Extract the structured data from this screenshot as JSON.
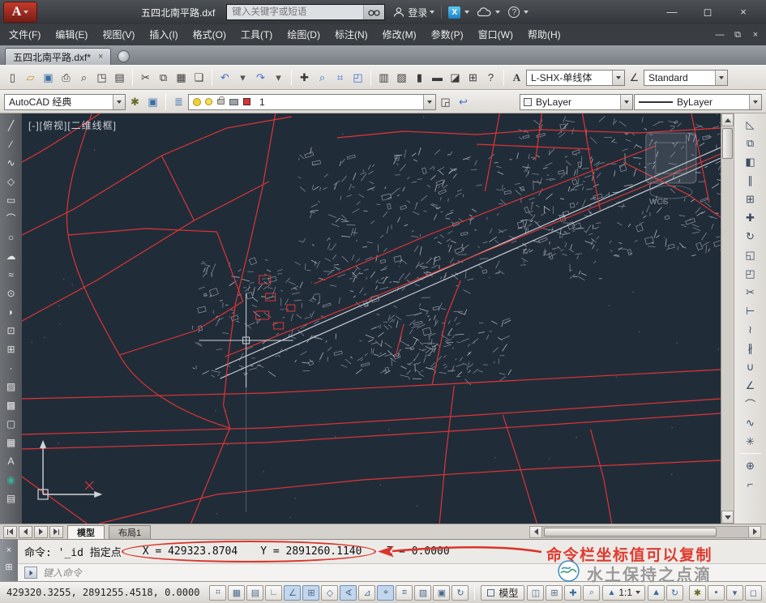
{
  "colors": {
    "accent_red": "#d9352a",
    "canvas_bg": "#212c39",
    "cad_red": "#e23535",
    "map_gray": "#97a0ac"
  },
  "title_bar": {
    "app_label": "A",
    "document_title": "五四北南平路.dxf",
    "search_placeholder": "键入关键字或短语",
    "login_label": "登录",
    "exchange_glyph": "X",
    "help_glyph": "?",
    "window_controls": {
      "minimize": "—",
      "maximize": "◻",
      "close": "×"
    }
  },
  "menu_bar": {
    "items": [
      "文件(F)",
      "编辑(E)",
      "视图(V)",
      "插入(I)",
      "格式(O)",
      "工具(T)",
      "绘图(D)",
      "标注(N)",
      "修改(M)",
      "参数(P)",
      "窗口(W)",
      "帮助(H)"
    ],
    "doc_window_controls": {
      "minimize": "—",
      "restore": "⧉",
      "close": "×"
    }
  },
  "tab_bar": {
    "tab_label": "五四北南平路.dxf*",
    "tab_close_glyph": "×"
  },
  "toolbar_standard": {
    "icons": [
      {
        "name": "new-file-icon",
        "glyph": "▯"
      },
      {
        "name": "open-file-icon",
        "glyph": "▱",
        "color": "#c89530"
      },
      {
        "name": "save-icon",
        "glyph": "▣",
        "color": "#3a6ea5"
      },
      {
        "name": "print-icon",
        "glyph": "⎙"
      },
      {
        "name": "plot-preview-icon",
        "glyph": "⌕"
      },
      {
        "name": "publish-icon",
        "glyph": "◳"
      },
      {
        "name": "export-dwf-icon",
        "glyph": "▤"
      },
      {
        "sep": true
      },
      {
        "name": "cut-icon",
        "glyph": "✂"
      },
      {
        "name": "copy-clip-icon",
        "glyph": "⧉"
      },
      {
        "name": "paste-icon",
        "glyph": "▦"
      },
      {
        "name": "match-properties-icon",
        "glyph": "❏"
      },
      {
        "sep": true
      },
      {
        "name": "undo-icon",
        "glyph": "↶",
        "color": "#3f6fd0"
      },
      {
        "name": "undo-caret-icon",
        "glyph": "▾",
        "color": "#555"
      },
      {
        "name": "redo-icon",
        "glyph": "↷",
        "color": "#3f6fd0"
      },
      {
        "name": "redo-caret-icon",
        "glyph": "▾",
        "color": "#555"
      },
      {
        "sep": true
      },
      {
        "name": "pan-icon",
        "glyph": "✚"
      },
      {
        "name": "zoom-realtime-icon",
        "glyph": "⌕",
        "color": "#3f6fd0"
      },
      {
        "name": "zoom-window-icon",
        "glyph": "⌗",
        "color": "#3f6fd0"
      },
      {
        "name": "zoom-previous-icon",
        "glyph": "◰",
        "color": "#3f6fd0"
      },
      {
        "sep": true
      },
      {
        "name": "properties-palette-icon",
        "glyph": "▥"
      },
      {
        "name": "designcenter-icon",
        "glyph": "▨"
      },
      {
        "name": "tool-palettes-icon",
        "glyph": "▮"
      },
      {
        "name": "sheet-set-manager-icon",
        "glyph": "▬"
      },
      {
        "name": "markup-set-manager-icon",
        "glyph": "◪"
      },
      {
        "name": "quickcalc-icon",
        "glyph": "⊞"
      },
      {
        "name": "help-icon",
        "glyph": "?"
      }
    ],
    "text_style_icon": "A",
    "text_style_value": "L-SHX-单线体",
    "dim_style_icon": "∠",
    "dim_style_value": "Standard"
  },
  "toolbar_properties": {
    "workspace_value": "AutoCAD 经典",
    "workspace_icons": [
      {
        "name": "workspace-settings-icon",
        "glyph": "✱",
        "color": "#6a6a28"
      },
      {
        "name": "workspace-save-icon",
        "glyph": "▣",
        "color": "#3a6ea5"
      }
    ],
    "layer_panel_icons": [
      {
        "name": "layer-properties-manager-icon",
        "glyph": "≣",
        "color": "#3a6ea5"
      }
    ],
    "layer_name": "1",
    "layer_tool_icons": [
      {
        "name": "make-layer-current-icon",
        "glyph": "◲"
      },
      {
        "name": "layer-previous-icon",
        "glyph": "↩",
        "color": "#3f6fd0"
      }
    ],
    "color_value": "ByLayer",
    "linetype_value": "ByLayer"
  },
  "canvas": {
    "viewport_label": "[-][俯视][二维线框]",
    "wcs_label": "WCS"
  },
  "left_toolbar": {
    "icons": [
      {
        "name": "line-icon",
        "glyph": "╱"
      },
      {
        "name": "construction-line-icon",
        "glyph": "∕"
      },
      {
        "name": "polyline-icon",
        "glyph": "∿"
      },
      {
        "name": "polygon-icon",
        "glyph": "◇"
      },
      {
        "name": "rectangle-icon",
        "glyph": "▭"
      },
      {
        "name": "arc-icon",
        "glyph": "⌒"
      },
      {
        "name": "circle-icon",
        "glyph": "○"
      },
      {
        "name": "revision-cloud-icon",
        "glyph": "☁"
      },
      {
        "name": "spline-icon",
        "glyph": "≈"
      },
      {
        "name": "ellipse-icon",
        "glyph": "⊙"
      },
      {
        "name": "ellipse-arc-icon",
        "glyph": "◗"
      },
      {
        "name": "insert-block-icon",
        "glyph": "⊡"
      },
      {
        "name": "create-block-icon",
        "glyph": "⊞"
      },
      {
        "name": "point-icon",
        "glyph": "∙"
      },
      {
        "name": "hatch-icon",
        "glyph": "▨"
      },
      {
        "name": "gradient-icon",
        "glyph": "▩"
      },
      {
        "name": "region-icon",
        "glyph": "▢"
      },
      {
        "name": "table-icon",
        "glyph": "▦"
      },
      {
        "name": "multiline-text-icon",
        "glyph": "A"
      },
      {
        "name": "point-style-icon",
        "glyph": "◉",
        "color": "#35b09a"
      },
      {
        "name": "named-views-icon",
        "glyph": "▤"
      }
    ]
  },
  "right_toolbar": {
    "icons": [
      {
        "name": "erase-icon",
        "glyph": "◺"
      },
      {
        "name": "copy-icon",
        "glyph": "⧉"
      },
      {
        "name": "mirror-icon",
        "glyph": "◧"
      },
      {
        "name": "offset-icon",
        "glyph": "∥"
      },
      {
        "name": "array-icon",
        "glyph": "⊞"
      },
      {
        "name": "move-icon",
        "glyph": "✚"
      },
      {
        "name": "rotate-icon",
        "glyph": "↻"
      },
      {
        "name": "scale-icon",
        "glyph": "◱"
      },
      {
        "name": "stretch-icon",
        "glyph": "◰"
      },
      {
        "name": "trim-icon",
        "glyph": "✂"
      },
      {
        "name": "extend-icon",
        "glyph": "⊢"
      },
      {
        "name": "break-at-point-icon",
        "glyph": "≀"
      },
      {
        "name": "break-icon",
        "glyph": "∦"
      },
      {
        "name": "join-icon",
        "glyph": "∪"
      },
      {
        "name": "chamfer-icon",
        "glyph": "∠"
      },
      {
        "name": "fillet-icon",
        "glyph": "⌒"
      },
      {
        "name": "blend-curves-icon",
        "glyph": "∿"
      },
      {
        "name": "explode-icon",
        "glyph": "✳"
      },
      {
        "sep": true
      },
      {
        "name": "osnap-settings-icon",
        "glyph": "⊕"
      },
      {
        "name": "ucs-icon",
        "glyph": "⌐"
      }
    ]
  },
  "bottom_tabs": {
    "model_label": "模型",
    "layout_label": "布局1"
  },
  "command_area": {
    "history_line": "命令: '_id 指定点",
    "coord_x": "X = 429323.8704",
    "coord_y": "Y = 2891260.1140",
    "coord_z": "Z = 0.0000",
    "annotation_text": "命令栏坐标值可以复制",
    "input_placeholder": "键入命令",
    "strip_icons": [
      {
        "name": "close-command-window-icon",
        "glyph": "×"
      },
      {
        "name": "command-customize-icon",
        "glyph": "⊞"
      }
    ]
  },
  "watermark": {
    "text": "水土保持之点滴"
  },
  "status_bar": {
    "coordinates": "429320.3255, 2891255.4518, 0.0000",
    "toggles": [
      {
        "name": "infer-constraints-toggle",
        "glyph": "⌗"
      },
      {
        "name": "snap-toggle",
        "glyph": "▦"
      },
      {
        "name": "grid-toggle",
        "glyph": "▤"
      },
      {
        "name": "ortho-toggle",
        "glyph": "∟"
      },
      {
        "name": "polar-tracking-toggle",
        "glyph": "∠",
        "active": true
      },
      {
        "name": "osnap-toggle",
        "glyph": "⊞",
        "active": true
      },
      {
        "name": "osnap-3d-toggle",
        "glyph": "◇"
      },
      {
        "name": "otrack-toggle",
        "glyph": "∢",
        "active": true
      },
      {
        "name": "dynamic-ucs-toggle",
        "glyph": "⊿"
      },
      {
        "name": "dynamic-input-toggle",
        "glyph": "⌖",
        "active": true
      },
      {
        "name": "lineweight-toggle",
        "glyph": "≡"
      },
      {
        "name": "transparency-toggle",
        "glyph": "▧"
      },
      {
        "name": "quick-properties-toggle",
        "glyph": "▣"
      },
      {
        "name": "selection-cycling-toggle",
        "glyph": "↻"
      }
    ],
    "model_label": "模型",
    "scale_label": "1:1",
    "annotation_scale_icon": "▲",
    "right_icons": [
      {
        "name": "quick-view-layouts-icon",
        "glyph": "◫"
      },
      {
        "name": "quick-view-drawings-icon",
        "glyph": "⊞"
      },
      {
        "name": "pan-status-icon",
        "glyph": "✚",
        "color": "#3a6ea5"
      },
      {
        "name": "zoom-status-icon",
        "glyph": "⌕",
        "color": "#3a6ea5"
      }
    ],
    "right_icons2": [
      {
        "name": "annotation-visibility-icon",
        "glyph": "▲",
        "color": "#3a6ea5"
      },
      {
        "name": "annotation-autoscale-icon",
        "glyph": "↻",
        "color": "#3a6ea5"
      }
    ],
    "tray_icons": [
      {
        "name": "workspace-switch-icon",
        "glyph": "✱",
        "color": "#6a6a28"
      },
      {
        "name": "toolbar-lock-icon",
        "glyph": "▪"
      },
      {
        "name": "status-tray-caret-icon",
        "glyph": "▾"
      },
      {
        "name": "clean-screen-icon",
        "glyph": "◻"
      }
    ]
  }
}
